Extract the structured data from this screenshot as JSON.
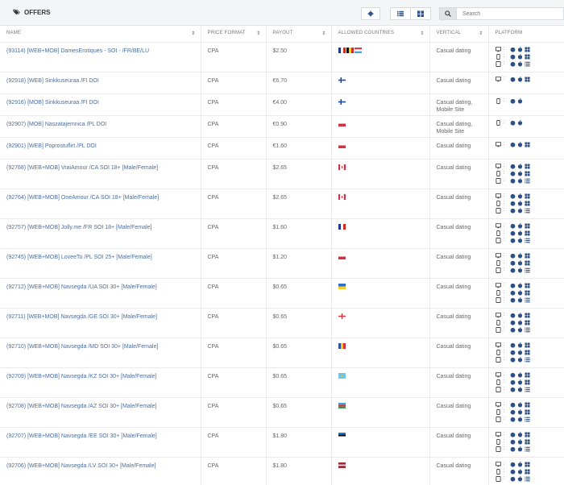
{
  "header": {
    "title": "OFFERS",
    "search_placeholder": "Search"
  },
  "columns": [
    {
      "label": "NAME",
      "sortable": true
    },
    {
      "label": "PRICE FORMAT",
      "sortable": true
    },
    {
      "label": "PAYOUT",
      "sortable": true
    },
    {
      "label": "ALLOWED COUNTRIES",
      "sortable": true
    },
    {
      "label": "VERTICAL",
      "sortable": true
    },
    {
      "label": "PLATFORM",
      "sortable": false
    }
  ],
  "flag_colors": {
    "fr": [
      "#1f3a93",
      "#ffffff",
      "#d52b1e"
    ],
    "be": [
      "#111111",
      "#f5d400",
      "#d52b1e"
    ],
    "lu": [
      "#e0353b",
      "#ffffff",
      "#3fa8e0"
    ],
    "fi": [
      "#ffffff",
      "#1b4f9c"
    ],
    "pl": [
      "#ffffff",
      "#d5303f"
    ],
    "ca": [
      "#d5303f",
      "#ffffff"
    ],
    "ua": [
      "#2f6ec4",
      "#f7cf2b"
    ],
    "ge": [
      "#ffffff",
      "#d5303f"
    ],
    "md": [
      "#2754a6",
      "#f1c40f",
      "#d5303f"
    ],
    "kz": [
      "#6ec7e6",
      "#e0b82b"
    ],
    "az": [
      "#3aa0d8",
      "#d5303f",
      "#2f9f4e"
    ],
    "ee": [
      "#2a6fc7",
      "#111111",
      "#ffffff"
    ],
    "lv": [
      "#9e2b35",
      "#ffffff"
    ]
  },
  "rows": [
    {
      "name": "(93114) [WEB+MOB] DamesErotiques - SOI - /FR/BE/LU",
      "format": "CPA",
      "payout": "$2.50",
      "flags": [
        "fr",
        "be",
        "lu"
      ],
      "vertical": "Casual dating",
      "platforms": [
        "desktop",
        "mobile",
        "tablet"
      ]
    },
    {
      "name": "(92918) [WEB] Sinkkuseuraa /FI DOI",
      "format": "CPA",
      "payout": "€6.70",
      "flags": [
        "fi"
      ],
      "vertical": "Casual dating",
      "platforms": [
        "desktop"
      ]
    },
    {
      "name": "(92916) [MOB] Sinkkuseuraa /FI DOI",
      "format": "CPA",
      "payout": "€4.00",
      "flags": [
        "fi"
      ],
      "vertical": "Casual dating, Mobile Site",
      "platforms": [
        "mobile-ios"
      ]
    },
    {
      "name": "(92907) [MOB] Naszatajemnica /PL DOI",
      "format": "CPA",
      "payout": "€0.90",
      "flags": [
        "pl"
      ],
      "vertical": "Casual dating, Mobile Site",
      "platforms": [
        "mobile-ios"
      ]
    },
    {
      "name": "(92901) [WEB] Poprostuflirt /PL DOI",
      "format": "CPA",
      "payout": "€1.60",
      "flags": [
        "pl"
      ],
      "vertical": "Casual dating",
      "platforms": [
        "desktop"
      ]
    },
    {
      "name": "(92768) [WEB+MOB] VraiAmour /CA SOI 18+ [Male/Female]",
      "format": "CPA",
      "payout": "$2.65",
      "flags": [
        "ca"
      ],
      "vertical": "Casual dating",
      "platforms": [
        "desktop",
        "mobile",
        "tablet"
      ]
    },
    {
      "name": "(92764) [WEB+MOB] OneAmour /CA SOI 18+ [Male/Female]",
      "format": "CPA",
      "payout": "$2.65",
      "flags": [
        "ca"
      ],
      "vertical": "Casual dating",
      "platforms": [
        "desktop",
        "mobile",
        "tablet"
      ]
    },
    {
      "name": "(92757) [WEB+MOB] Jolly.me /FR SOI 18+ [Male/Female]",
      "format": "CPA",
      "payout": "$1.60",
      "flags": [
        "fr"
      ],
      "vertical": "Casual dating",
      "platforms": [
        "desktop",
        "mobile",
        "tablet"
      ]
    },
    {
      "name": "(92745) [WEB+MOB] LoveeTo /PL SOI 25+ [Male/Female]",
      "format": "CPA",
      "payout": "$1.20",
      "flags": [
        "pl"
      ],
      "vertical": "Casual dating",
      "platforms": [
        "desktop",
        "mobile",
        "tablet"
      ]
    },
    {
      "name": "(92712) [WEB+MOB] Navsegda /UA SOI 30+ [Male/Female]",
      "format": "CPA",
      "payout": "$0.65",
      "flags": [
        "ua"
      ],
      "vertical": "Casual dating",
      "platforms": [
        "desktop",
        "mobile",
        "tablet"
      ]
    },
    {
      "name": "(92711) [WEB+MOB] Navsegda /GE SOI 30+ [Male/Female]",
      "format": "CPA",
      "payout": "$0.65",
      "flags": [
        "ge"
      ],
      "vertical": "Casual dating",
      "platforms": [
        "desktop",
        "mobile",
        "tablet"
      ]
    },
    {
      "name": "(92710) [WEB+MOB] Navsegda /MD SOI 30+ [Male/Female]",
      "format": "CPA",
      "payout": "$0.65",
      "flags": [
        "md"
      ],
      "vertical": "Casual dating",
      "platforms": [
        "desktop",
        "mobile",
        "tablet"
      ]
    },
    {
      "name": "(92709) [WEB+MOB] Navsegda /KZ SOI 30+ [Male/Female]",
      "format": "CPA",
      "payout": "$0.65",
      "flags": [
        "kz"
      ],
      "vertical": "Casual dating",
      "platforms": [
        "desktop",
        "mobile",
        "tablet"
      ]
    },
    {
      "name": "(92708) [WEB+MOB] Navsegda /AZ SOI 30+ [Male/Female]",
      "format": "CPA",
      "payout": "$0.65",
      "flags": [
        "az"
      ],
      "vertical": "Casual dating",
      "platforms": [
        "desktop",
        "mobile",
        "tablet"
      ]
    },
    {
      "name": "(92707) [WEB+MOB] Navsegda /EE SOI 30+ [Male/Female]",
      "format": "CPA",
      "payout": "$1.80",
      "flags": [
        "ee"
      ],
      "vertical": "Casual dating",
      "platforms": [
        "desktop",
        "mobile",
        "tablet"
      ]
    },
    {
      "name": "(92706) [WEB+MOB] Navsegda /LV SOI 30+ [Male/Female]",
      "format": "CPA",
      "payout": "$1.80",
      "flags": [
        "lv"
      ],
      "vertical": "Casual dating",
      "platforms": [
        "desktop",
        "mobile",
        "tablet"
      ]
    }
  ]
}
